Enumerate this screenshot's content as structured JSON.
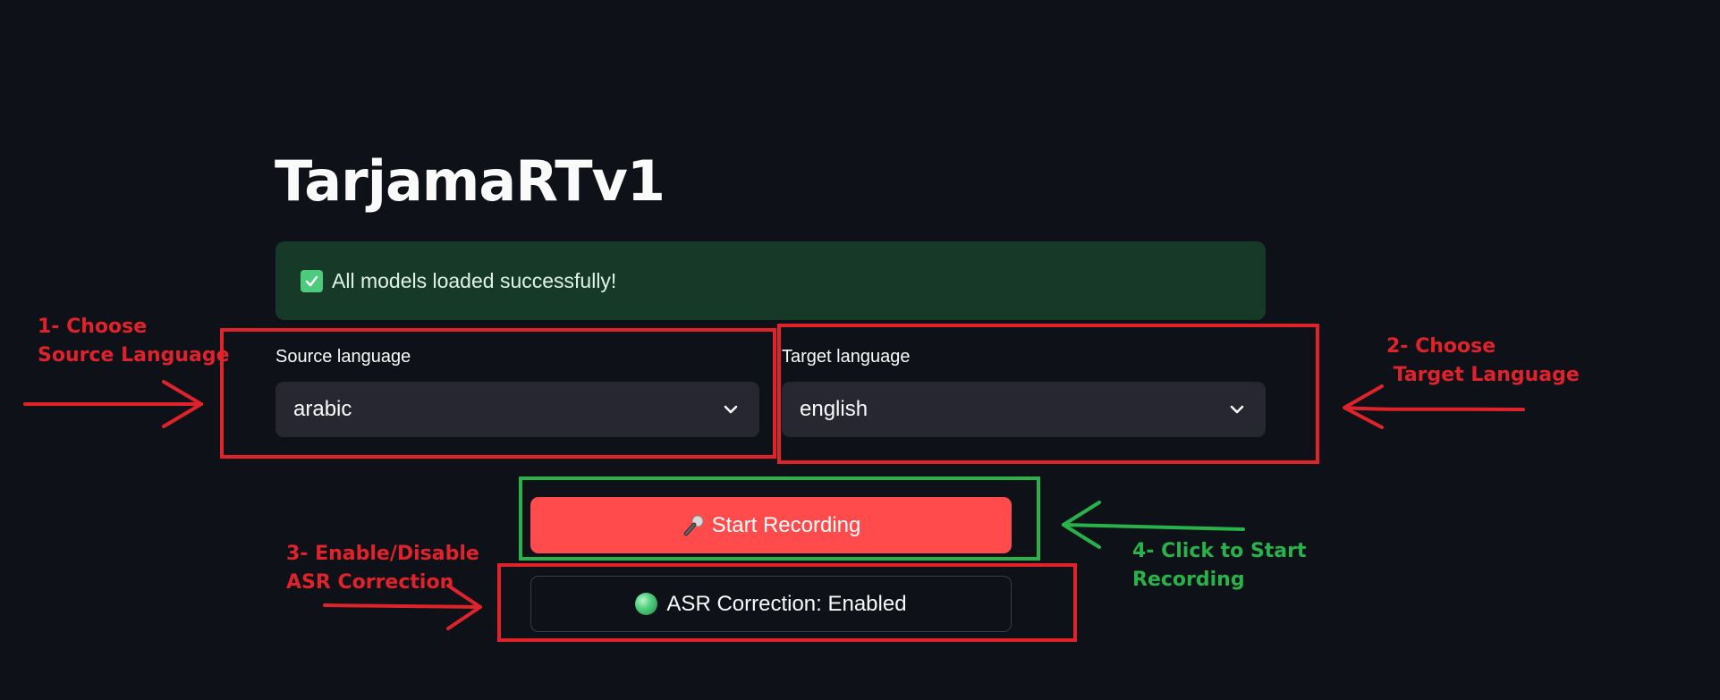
{
  "app": {
    "title": "TarjamaRTv1"
  },
  "alert": {
    "icon": "check-mark-icon",
    "text": "All models loaded successfully!"
  },
  "source_language": {
    "label": "Source language",
    "value": "arabic"
  },
  "target_language": {
    "label": "Target language",
    "value": "english"
  },
  "record_button": {
    "icon": "microphone-icon",
    "label": "Start Recording"
  },
  "asr_toggle": {
    "icon": "green-circle-icon",
    "label": "ASR Correction: Enabled"
  },
  "annotations": {
    "step1": "1- Choose\nSource Language",
    "step2": "2- Choose\n Target Language",
    "step3": "3- Enable/Disable\nASR Correction",
    "step4": "4- Click to Start\nRecording"
  },
  "colors": {
    "background": "#0e1117",
    "alert_background": "#173928",
    "select_background": "#262730",
    "primary_button": "#ff4b4b",
    "annotation_red": "#e0232b",
    "annotation_green": "#27b34a"
  }
}
